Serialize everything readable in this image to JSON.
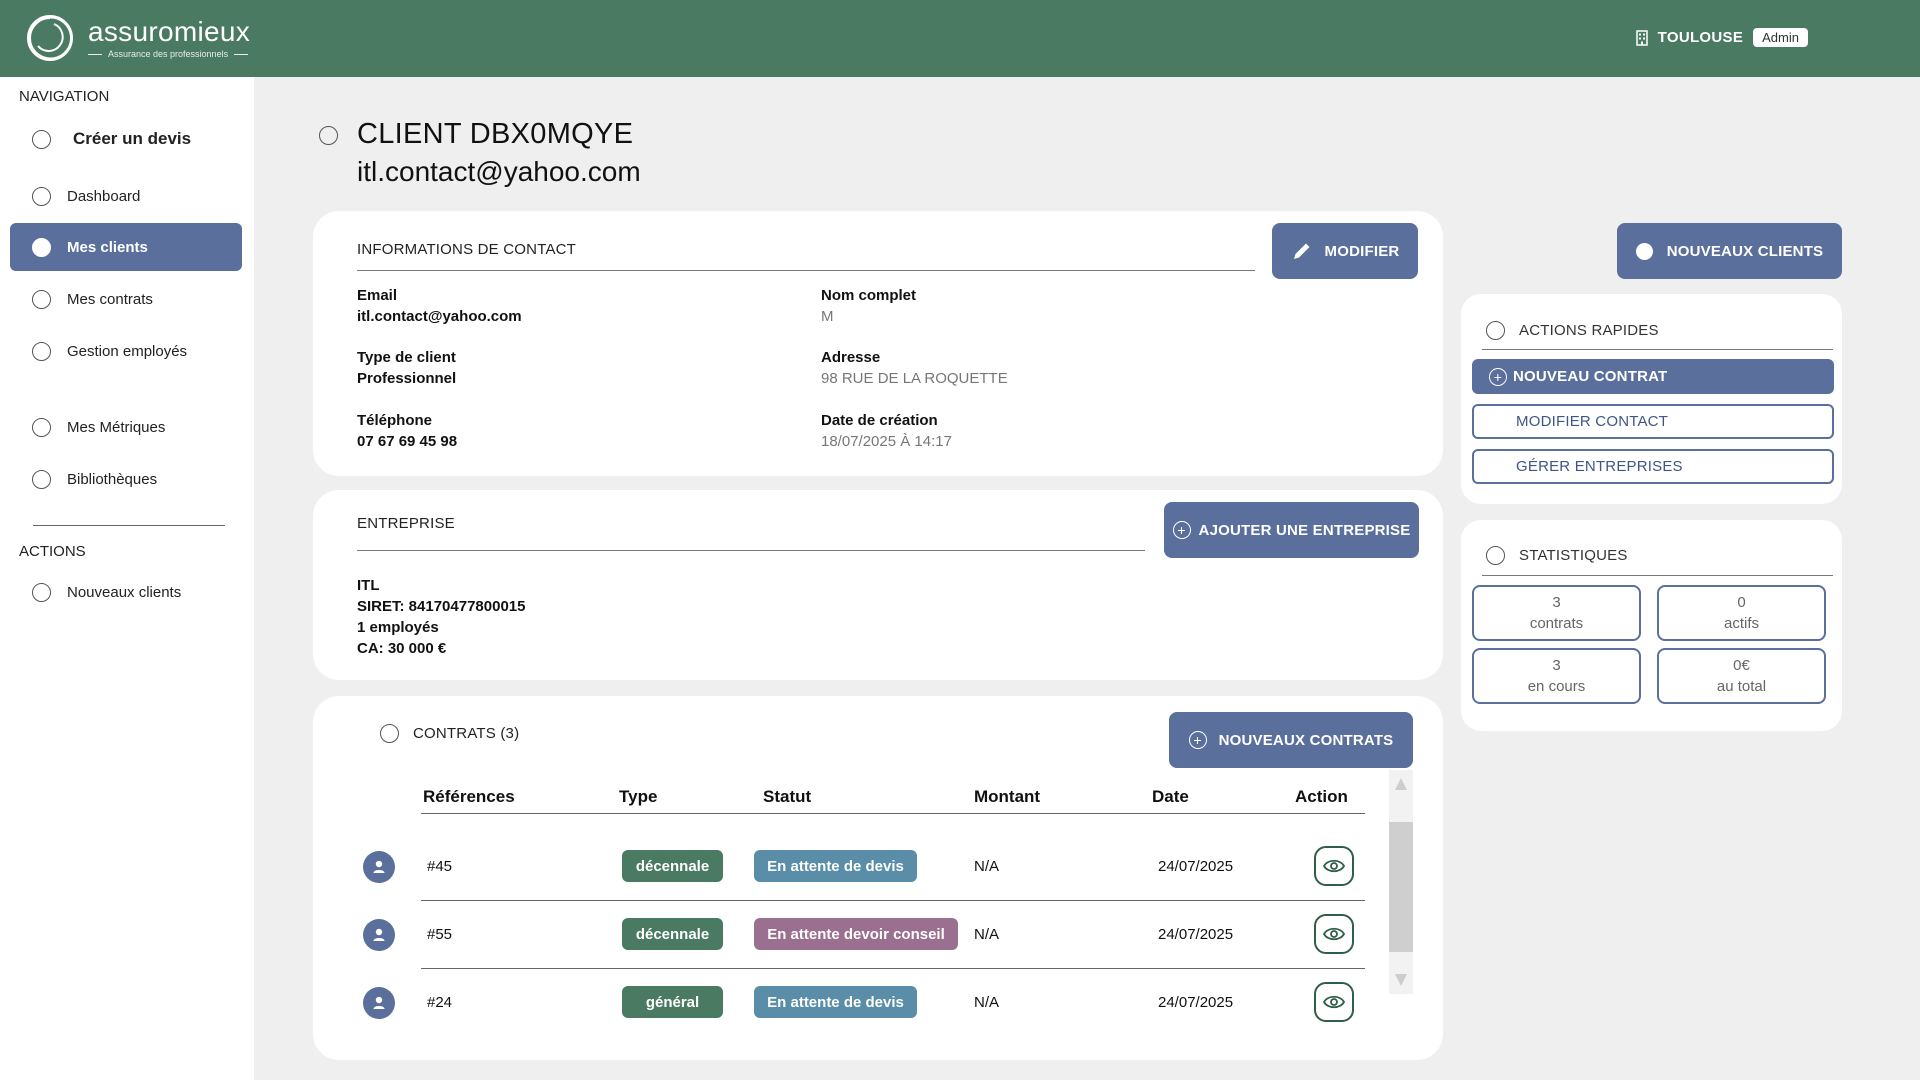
{
  "header": {
    "brand_name": "assuromieux",
    "brand_tagline": "Assurance des professionnels",
    "city": "TOULOUSE",
    "role_badge": "Admin",
    "color": "#4a7a61"
  },
  "sidebar": {
    "nav_heading": "NAVIGATION",
    "items": [
      {
        "label": "Créer un devis",
        "icon": "radio-icon"
      },
      {
        "label": "Dashboard",
        "icon": "radio-icon"
      },
      {
        "label": "Mes clients",
        "icon": "radio-icon",
        "active": true
      },
      {
        "label": "Mes contrats",
        "icon": "radio-icon"
      },
      {
        "label": "Gestion employés",
        "icon": "radio-icon"
      },
      {
        "label": "Mes Métriques",
        "icon": "radio-icon"
      },
      {
        "label": "Bibliothèques",
        "icon": "radio-icon"
      }
    ],
    "actions_heading": "ACTIONS",
    "action_items": [
      {
        "label": "Nouveaux clients",
        "icon": "radio-icon"
      }
    ],
    "active_color": "#5a6f9c"
  },
  "page": {
    "title": "CLIENT DBX0MQYE",
    "subtitle": "itl.contact@yahoo.com"
  },
  "contact": {
    "heading": "INFORMATIONS DE CONTACT",
    "edit_button": "MODIFIER",
    "email_label": "Email",
    "email_value": "itl.contact@yahoo.com",
    "type_label": "Type de client",
    "type_value": "Professionnel",
    "phone_label": "Téléphone",
    "phone_value": "07 67 69 45 98",
    "name_label": "Nom complet",
    "name_value": "M",
    "address_label": "Adresse",
    "address_value": "98 RUE DE LA ROQUETTE",
    "created_label": "Date de création",
    "created_value": "18/07/2025 À 14:17"
  },
  "company": {
    "heading": "ENTREPRISE",
    "add_button": "AJOUTER UNE ENTREPRISE",
    "name": "ITL",
    "siret": "SIRET: 84170477800015",
    "employees": "1 employés",
    "revenue": "CA: 30 000 €"
  },
  "contracts": {
    "heading": "CONTRATS (3)",
    "new_button": "NOUVEAUX CONTRATS",
    "columns": [
      "Références",
      "Type",
      "Statut",
      "Montant",
      "Date",
      "Action"
    ],
    "rows": [
      {
        "ref": "#45",
        "type": "décennale",
        "type_color": "#4a7a61",
        "status": "En attente de devis",
        "status_color": "#5a8ea8",
        "amount": "N/A",
        "date": "24/07/2025"
      },
      {
        "ref": "#55",
        "type": "décennale",
        "type_color": "#4a7a61",
        "status": "En attente devoir conseil",
        "status_color": "#9a6f8f",
        "amount": "N/A",
        "date": "24/07/2025"
      },
      {
        "ref": "#24",
        "type": "général",
        "type_color": "#4a7a61",
        "status": "En attente de devis",
        "status_color": "#5a8ea8",
        "amount": "N/A",
        "date": "24/07/2025"
      }
    ]
  },
  "right_panel": {
    "new_clients_button": "NOUVEAUX CLIENTS",
    "quick_actions_heading": "ACTIONS RAPIDES",
    "quick_actions": [
      "NOUVEAU CONTRAT",
      "MODIFIER CONTACT",
      "GÉRER ENTREPRISES"
    ],
    "stats_heading": "STATISTIQUES",
    "stats": [
      {
        "value": "3",
        "label": "contrats"
      },
      {
        "value": "0",
        "label": "actifs"
      },
      {
        "value": "3",
        "label": "en cours"
      },
      {
        "value": "0€",
        "label": "au total"
      }
    ]
  }
}
